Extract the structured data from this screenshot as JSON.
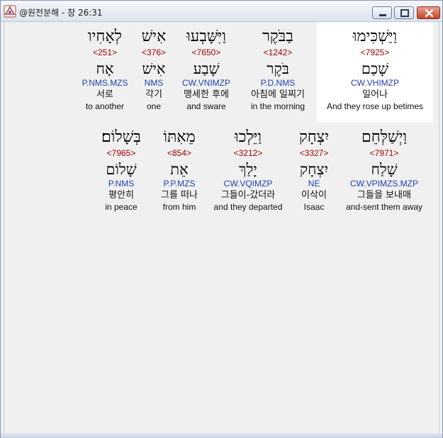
{
  "window": {
    "title": "@원전분해 - 창 26:31"
  },
  "rows": [
    {
      "words": [
        {
          "hebrew": "וַיַּשְׁכִּימוּ",
          "strong": "<7925>",
          "lemma": "שָׁכַם",
          "parse": "CW.VHIMZP",
          "korean": "일어나",
          "english": "And they rose up betimes",
          "selected": true
        },
        {
          "hebrew": "בַבֹּקֶר",
          "strong": "<1242>",
          "lemma": "בֹּקֶר",
          "parse": "P.D.NMS",
          "korean": "아침에 일찌기",
          "english": "in the morning"
        },
        {
          "hebrew": "וַיִּשָּׁבְעוּ",
          "strong": "<7650>",
          "lemma": "שָׁבַע",
          "parse": "CW.VNIMZP",
          "korean": "맹세한 후에",
          "english": "and sware"
        },
        {
          "hebrew": "אִישׁ",
          "strong": "<376>",
          "lemma": "אִישׁ",
          "parse": "NMS",
          "korean": "각기",
          "english": "one"
        },
        {
          "hebrew": "לְאָחִיו",
          "strong": "<251>",
          "lemma": "אָח",
          "parse": "P.NMS.MZS",
          "korean": "서로",
          "english": "to another"
        }
      ]
    },
    {
      "words": [
        {
          "hebrew": "וַיְשַׁלְּחֵם",
          "strong": "<7971>",
          "lemma": "שָׁלַח",
          "parse": "CW.VPIMZS.MZP",
          "korean": "그들을 보내매",
          "english": "and-sent them away"
        },
        {
          "hebrew": "יִצְחָק",
          "strong": "<3327>",
          "lemma": "יִצְחָק",
          "parse": "NE",
          "korean": "이삭이",
          "english": "Isaac"
        },
        {
          "hebrew": "וַיֵּלְכוּ",
          "strong": "<3212>",
          "lemma": "יָלַךְ",
          "parse": "CW.VQIMZP",
          "korean": "그들이-갔더라",
          "english": "and they departed"
        },
        {
          "hebrew": "מֵאִתּוֹ",
          "strong": "<854>",
          "lemma": "אֵת",
          "parse": "P.P.MZS",
          "korean": "그를 떠나",
          "english": "from him"
        },
        {
          "hebrew": "בְּשָׁלוֹם׃",
          "strong": "<7965>",
          "lemma": "שָׁלוֹם",
          "parse": "P.NMS",
          "korean": "평안히",
          "english": "in peace"
        }
      ]
    }
  ]
}
